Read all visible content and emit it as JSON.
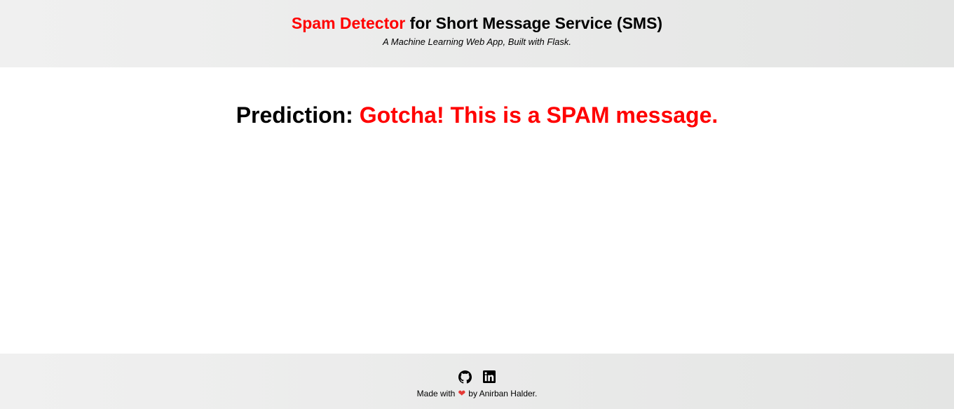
{
  "header": {
    "title_accent": "Spam Detector",
    "title_rest": " for Short Message Service (SMS)",
    "subtitle": "A Machine Learning Web App, Built with Flask."
  },
  "result": {
    "label": "Prediction: ",
    "value": "Gotcha! This is a SPAM message."
  },
  "footer": {
    "made_with": "Made with",
    "heart": "❤",
    "by": "by Anirban Halder.",
    "icons": [
      "github-icon",
      "linkedin-icon"
    ]
  },
  "colors": {
    "accent": "#ff0000"
  }
}
